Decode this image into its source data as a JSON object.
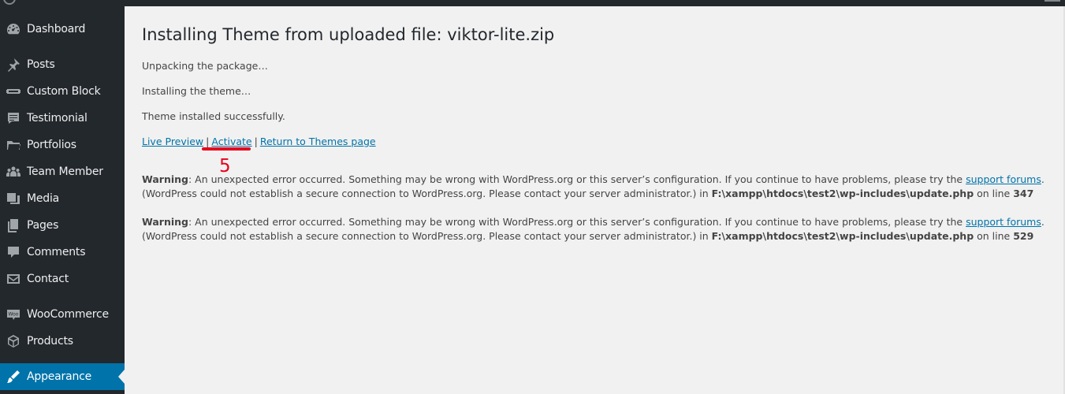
{
  "sidebar": {
    "items": [
      {
        "label": "Dashboard",
        "icon": "dashboard-icon"
      },
      {
        "label": "Posts",
        "icon": "pin-icon"
      },
      {
        "label": "Custom Block",
        "icon": "block-icon"
      },
      {
        "label": "Testimonial",
        "icon": "testimonial-icon"
      },
      {
        "label": "Portfolios",
        "icon": "folder-icon"
      },
      {
        "label": "Team Member",
        "icon": "team-icon"
      },
      {
        "label": "Media",
        "icon": "media-icon"
      },
      {
        "label": "Pages",
        "icon": "pages-icon"
      },
      {
        "label": "Comments",
        "icon": "comments-icon"
      },
      {
        "label": "Contact",
        "icon": "mail-icon"
      },
      {
        "label": "WooCommerce",
        "icon": "woocommerce-icon"
      },
      {
        "label": "Products",
        "icon": "box-icon"
      },
      {
        "label": "Appearance",
        "icon": "brush-icon"
      }
    ],
    "current": "Appearance"
  },
  "main": {
    "title": "Installing Theme from uploaded file: viktor-lite.zip",
    "messages": [
      "Unpacking the package…",
      "Installing the theme…",
      "Theme installed successfully."
    ],
    "actions": {
      "live_preview": "Live Preview",
      "activate": "Activate",
      "return": "Return to Themes page",
      "separator": "|"
    },
    "annotation": {
      "step": "5"
    },
    "warnings": [
      {
        "label": "Warning",
        "text_before": ": An unexpected error occurred. Something may be wrong with WordPress.org or this server’s configuration. If you continue to have problems, please try the ",
        "link": "support forums",
        "text_after": ". (WordPress could not establish a secure connection to WordPress.org. Please contact your server administrator.) in ",
        "file": "F:\\xampp\\htdocs\\test2\\wp-includes\\update.php",
        "on_line": " on line ",
        "line": "347"
      },
      {
        "label": "Warning",
        "text_before": ": An unexpected error occurred. Something may be wrong with WordPress.org or this server’s configuration. If you continue to have problems, please try the ",
        "link": "support forums",
        "text_after": ". (WordPress could not establish a secure connection to WordPress.org. Please contact your server administrator.) in ",
        "file": "F:\\xampp\\htdocs\\test2\\wp-includes\\update.php",
        "on_line": " on line ",
        "line": "529"
      }
    ]
  },
  "colors": {
    "sidebar_bg": "#23282d",
    "accent": "#0073aa",
    "annotation": "#e8001c",
    "page_bg": "#f1f1f1"
  }
}
